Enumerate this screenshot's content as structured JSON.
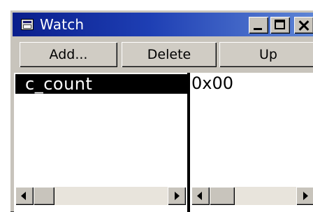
{
  "window": {
    "title": "Watch",
    "icon": "watch-window-icon"
  },
  "toolbar": {
    "add_label": "Add...",
    "delete_label": "Delete",
    "up_label": "Up"
  },
  "watch_list": {
    "rows": [
      {
        "name": "c_count",
        "value": "0x00",
        "selected": true
      }
    ]
  },
  "colors": {
    "titlebar_start": "#0a1e8c",
    "titlebar_end": "#5f86d6",
    "selection_bg": "#000000",
    "selection_fg": "#ffffff",
    "face": "#c8c4bc"
  }
}
